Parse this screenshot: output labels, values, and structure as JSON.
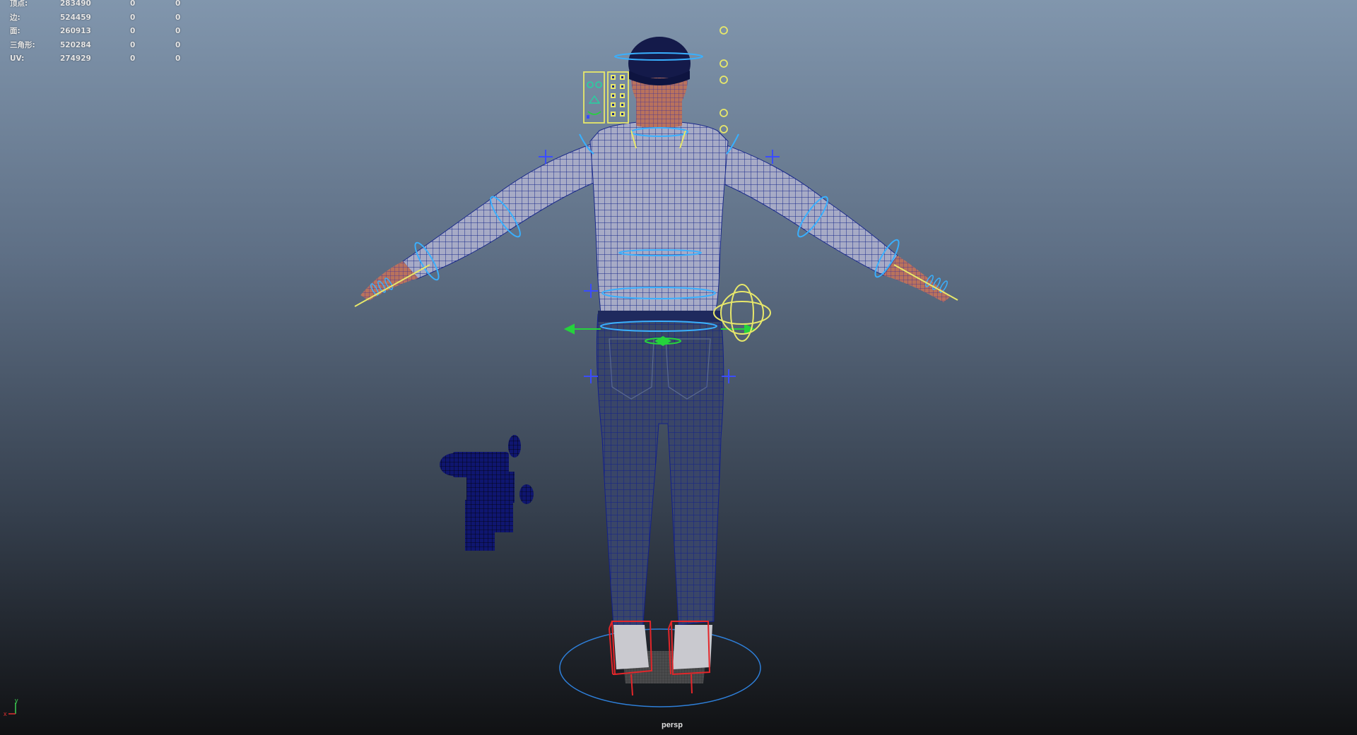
{
  "viewport": {
    "camera_name": "persp",
    "background_top_color": "#8094ab",
    "background_bottom_color": "#111214"
  },
  "hud": {
    "rows": [
      {
        "label": "顶点:",
        "total": "283490",
        "selected": "0",
        "triangles": "0"
      },
      {
        "label": "边:",
        "total": "524459",
        "selected": "0",
        "triangles": "0"
      },
      {
        "label": "面:",
        "total": "260913",
        "selected": "0",
        "triangles": "0"
      },
      {
        "label": "三角形:",
        "total": "520284",
        "selected": "0",
        "triangles": "0"
      },
      {
        "label": "UV:",
        "total": "274929",
        "selected": "0",
        "triangles": "0"
      }
    ]
  },
  "axis": {
    "y_label": "y",
    "x_label": "x",
    "y_color": "#3ccf52",
    "x_color": "#e03030"
  },
  "scene": {
    "character_mesh_color": "#1a2f9a",
    "shirt_color": "#8a8fb5",
    "jeans_color": "#2c3a78",
    "skin_color": "#c77a5e",
    "controller_cyan": "#39b0ff",
    "controller_blue": "#3a4cff",
    "controller_yellow": "#e8e86a",
    "controller_green": "#25d33c",
    "foot_box_red": "#e3262a",
    "icons": [
      "face-control-panel-icon",
      "camera-prop-icon",
      "root-circle-icon",
      "pivot-cross-icon"
    ]
  }
}
